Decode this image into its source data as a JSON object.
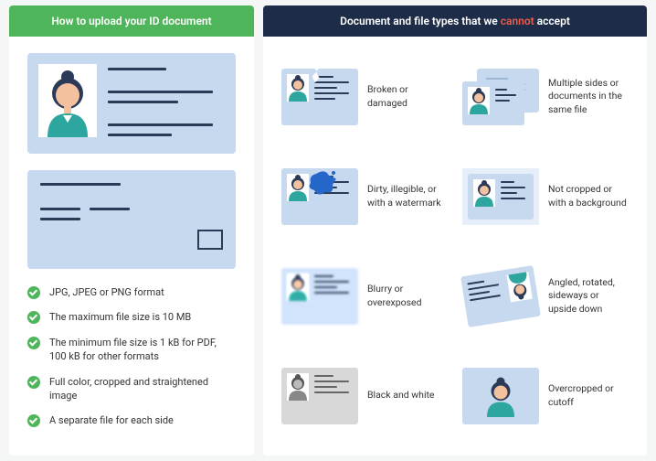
{
  "left": {
    "header": "How to upload your ID document",
    "requirements": [
      "JPG, JPEG or PNG format",
      "The maximum file size is 10 MB",
      "The minimum file size is 1 kB for PDF, 100 kB for other formats",
      "Full color, cropped and straightened image",
      "A separate file for each side"
    ]
  },
  "right": {
    "header_pre": "Document and file types that we ",
    "header_red": "cannot",
    "header_post": " accept",
    "items": [
      "Broken or damaged",
      "Multiple sides or documents in the same file",
      "Dirty, illegible, or with a watermark",
      "Not cropped or with a background",
      "Blurry or overexposed",
      "Angled, rotated, sideways or upside down",
      "Black and white",
      "Overcropped or cutoff"
    ]
  }
}
